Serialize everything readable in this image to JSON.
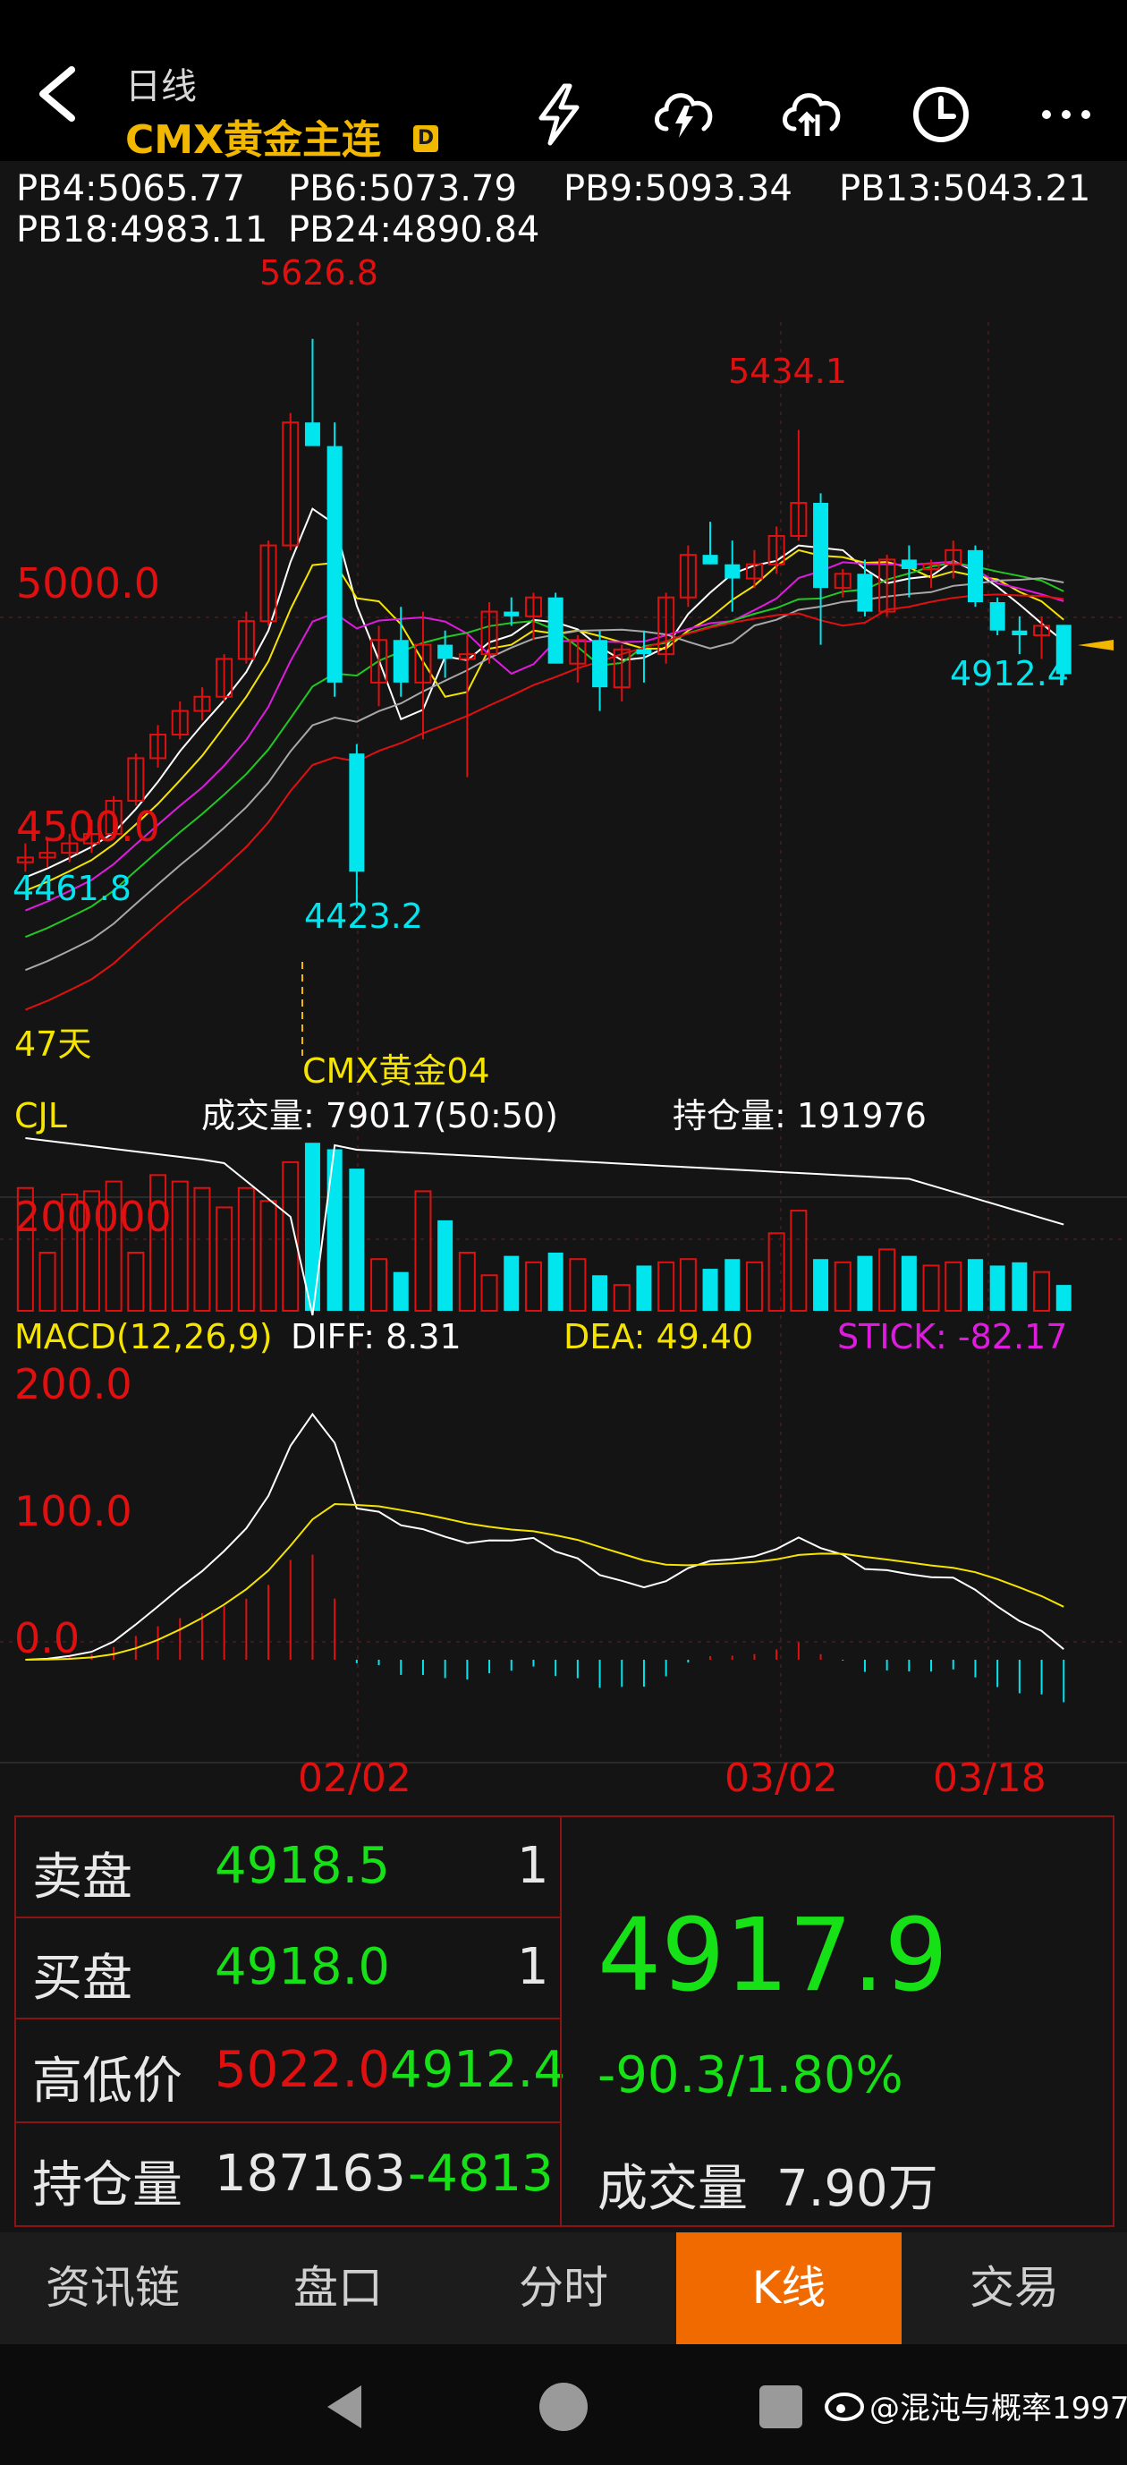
{
  "header": {
    "period": "日线",
    "instrument": "CMX黄金主连",
    "badge": "D",
    "icons": [
      "lightning-icon",
      "cloud-download-icon",
      "cloud-upload-icon",
      "clock-icon",
      "more-icon"
    ]
  },
  "ma_legend": [
    {
      "label": "PB4:5065.77",
      "color": "#ffffff"
    },
    {
      "label": "PB6:5073.79",
      "color": "#f5e400"
    },
    {
      "label": "PB9:5093.34",
      "color": "#e01be0"
    },
    {
      "label": "PB13:5043.21",
      "color": "#22c822"
    },
    {
      "label": "PB18:4983.11",
      "color": "#a8a8a8"
    },
    {
      "label": "PB24:4890.84",
      "color": "#e01010"
    }
  ],
  "price_chart": {
    "y_labels": [
      "5000.0",
      "4500.0"
    ],
    "annotations": {
      "high_left": "5626.8",
      "high_right": "5434.1",
      "low_mid": "4423.2",
      "left_start": "4461.8",
      "last_low": "4912.4"
    },
    "days_label": "47天",
    "contract_label": "CMX黄金04"
  },
  "volume_panel": {
    "indicator": "CJL",
    "volume_label": "成交量: 79017(50:50)",
    "open_interest_label": "持仓量: 191976",
    "y_label": "200000"
  },
  "macd_panel": {
    "title": "MACD(12,26,9)",
    "diff": "DIFF: 8.31",
    "dea": "DEA: 49.40",
    "stick": "STICK: -82.17",
    "y_labels": [
      "200.0",
      "100.0",
      "0.0"
    ]
  },
  "x_dates": [
    "02/02",
    "03/02",
    "03/18"
  ],
  "chart_data": {
    "type": "candlestick",
    "ohlc": [
      [
        4520,
        4560,
        4500,
        4530
      ],
      [
        4530,
        4570,
        4510,
        4540
      ],
      [
        4540,
        4580,
        4520,
        4560
      ],
      [
        4560,
        4610,
        4540,
        4580
      ],
      [
        4580,
        4660,
        4570,
        4650
      ],
      [
        4650,
        4750,
        4640,
        4740
      ],
      [
        4740,
        4810,
        4720,
        4790
      ],
      [
        4790,
        4860,
        4780,
        4840
      ],
      [
        4840,
        4890,
        4820,
        4870
      ],
      [
        4870,
        4960,
        4860,
        4950
      ],
      [
        4950,
        5050,
        4940,
        5030
      ],
      [
        5030,
        5200,
        5020,
        5190
      ],
      [
        5190,
        5470,
        5180,
        5450
      ],
      [
        5450,
        5626.8,
        5430,
        5400
      ],
      [
        5400,
        5450,
        4870,
        4900
      ],
      [
        4750,
        4770,
        4423.2,
        4500
      ],
      [
        4900,
        5020,
        4850,
        4990
      ],
      [
        4990,
        5060,
        4870,
        4900
      ],
      [
        4900,
        5050,
        4780,
        4980
      ],
      [
        4980,
        5010,
        4910,
        4950
      ],
      [
        4950,
        5000,
        4700,
        4960
      ],
      [
        4960,
        5070,
        4940,
        5050
      ],
      [
        5050,
        5080,
        5020,
        5040
      ],
      [
        5040,
        5090,
        4990,
        5080
      ],
      [
        5080,
        5090,
        4980,
        4940
      ],
      [
        4940,
        5000,
        4900,
        4990
      ],
      [
        4990,
        5010,
        4840,
        4890
      ],
      [
        4890,
        4980,
        4860,
        4970
      ],
      [
        4970,
        5010,
        4900,
        4960
      ],
      [
        4960,
        5090,
        4940,
        5080
      ],
      [
        5080,
        5190,
        5060,
        5170
      ],
      [
        5170,
        5240,
        5150,
        5150
      ],
      [
        5150,
        5200,
        5050,
        5120
      ],
      [
        5120,
        5180,
        5100,
        5150
      ],
      [
        5150,
        5230,
        5130,
        5210
      ],
      [
        5210,
        5434.1,
        5200,
        5280
      ],
      [
        5280,
        5300,
        4980,
        5100
      ],
      [
        5100,
        5140,
        5080,
        5130
      ],
      [
        5130,
        5160,
        5040,
        5050
      ],
      [
        5050,
        5170,
        5040,
        5160
      ],
      [
        5160,
        5190,
        5080,
        5140
      ],
      [
        5140,
        5160,
        5100,
        5150
      ],
      [
        5150,
        5200,
        5120,
        5180
      ],
      [
        5180,
        5190,
        5060,
        5070
      ],
      [
        5070,
        5080,
        5000,
        5010
      ],
      [
        5010,
        5040,
        4960,
        5000
      ],
      [
        5000,
        5040,
        4950,
        5020
      ],
      [
        5022,
        5022,
        4912.4,
        4917.9
      ]
    ],
    "ma": {
      "PB4": 5065.77,
      "PB6": 5073.79,
      "PB9": 5093.34,
      "PB13": 5043.21,
      "PB18": 4983.11,
      "PB24": 4890.84
    },
    "volume": [
      190000,
      90000,
      180000,
      185000,
      200000,
      90000,
      210000,
      200000,
      190000,
      160000,
      190000,
      170000,
      230000,
      260000,
      250000,
      220000,
      80000,
      60000,
      185000,
      140000,
      90000,
      55000,
      85000,
      75000,
      90000,
      80000,
      55000,
      40000,
      70000,
      75000,
      80000,
      65000,
      80000,
      75000,
      120000,
      155000,
      80000,
      75000,
      85000,
      95000,
      85000,
      70000,
      75000,
      80000,
      70000,
      75000,
      60000,
      40000
    ],
    "open_interest_last": 191976,
    "macd": {
      "diff": 8.31,
      "dea": 49.4,
      "stick": -82.17
    },
    "x_ticks": [
      "02/02",
      "03/02",
      "03/18"
    ]
  },
  "quote": {
    "ask_label": "卖盘",
    "ask_price": "4918.5",
    "ask_qty": "1",
    "bid_label": "买盘",
    "bid_price": "4918.0",
    "bid_qty": "1",
    "hl_label": "高低价",
    "high": "5022.0",
    "low": "4912.4",
    "oi_label": "持仓量",
    "oi_value": "187163",
    "oi_change": "-4813",
    "last_price": "4917.9",
    "change": "-90.3/1.80%",
    "volume_label": "成交量",
    "volume_value": "7.90万"
  },
  "tabs": [
    {
      "label": "资讯链",
      "active": false
    },
    {
      "label": "盘口",
      "active": false
    },
    {
      "label": "分时",
      "active": false
    },
    {
      "label": "K线",
      "active": true
    },
    {
      "label": "交易",
      "active": false
    }
  ],
  "watermark": "@混沌与概率1997",
  "colors": {
    "up": "#e01010",
    "down": "#00e5ee",
    "accent": "#f06a00",
    "gold": "#f2b800",
    "green": "#16e016"
  }
}
